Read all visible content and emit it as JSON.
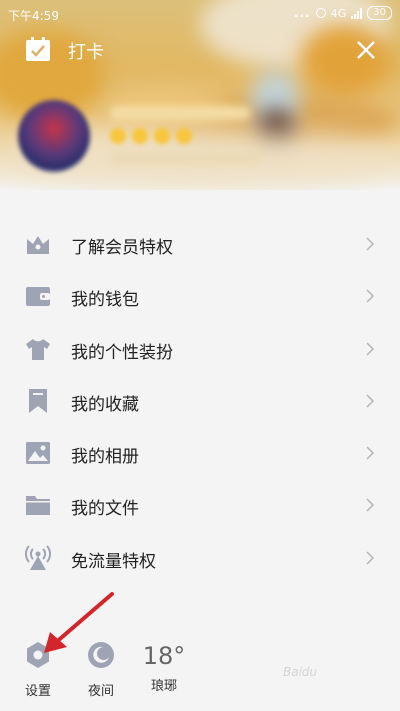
{
  "status_bar": {
    "time": "下午4:59",
    "signal_dots": "...",
    "network": "4G",
    "battery": "30"
  },
  "header": {
    "title": "打卡",
    "icons": {
      "checkin": "calendar-check-icon",
      "close": "close-icon"
    }
  },
  "menu": {
    "items": [
      {
        "label": "了解会员特权",
        "icon": "crown-icon"
      },
      {
        "label": "我的钱包",
        "icon": "wallet-icon"
      },
      {
        "label": "我的个性装扮",
        "icon": "shirt-icon"
      },
      {
        "label": "我的收藏",
        "icon": "bookmark-icon"
      },
      {
        "label": "我的相册",
        "icon": "image-icon"
      },
      {
        "label": "我的文件",
        "icon": "folder-icon"
      },
      {
        "label": "免流量特权",
        "icon": "broadcast-icon"
      }
    ]
  },
  "bottom": {
    "settings_label": "设置",
    "night_label": "夜间",
    "temperature": "18°",
    "city": "琅琊"
  },
  "colors": {
    "icon": "#9fa4b4",
    "arrow": "#d2262c",
    "text": "#222222"
  }
}
